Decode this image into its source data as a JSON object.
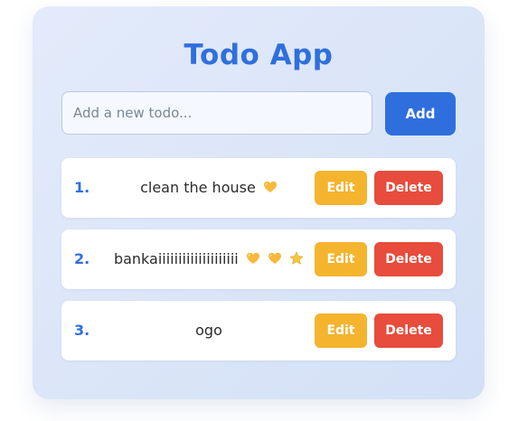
{
  "app": {
    "title": "Todo App"
  },
  "new_todo": {
    "placeholder": "Add a new todo...",
    "value": "",
    "add_label": "Add"
  },
  "todos": [
    {
      "number": "1.",
      "text": "clean the house",
      "emojis": [
        "yellow-heart-icon"
      ],
      "edit_label": "Edit",
      "delete_label": "Delete"
    },
    {
      "number": "2.",
      "text": "bankaiiiiiiiiiiiiiiiiiiii",
      "emojis": [
        "yellow-heart-icon",
        "yellow-heart-icon",
        "star-icon"
      ],
      "edit_label": "Edit",
      "delete_label": "Delete"
    },
    {
      "number": "3.",
      "text": "ogo",
      "emojis": [],
      "edit_label": "Edit",
      "delete_label": "Delete"
    }
  ],
  "colors": {
    "accent": "#2f6fdd",
    "edit": "#f4b42e",
    "delete": "#e74c3c",
    "emoji_heart": "#f6b93b",
    "emoji_star": "#f5c542"
  }
}
